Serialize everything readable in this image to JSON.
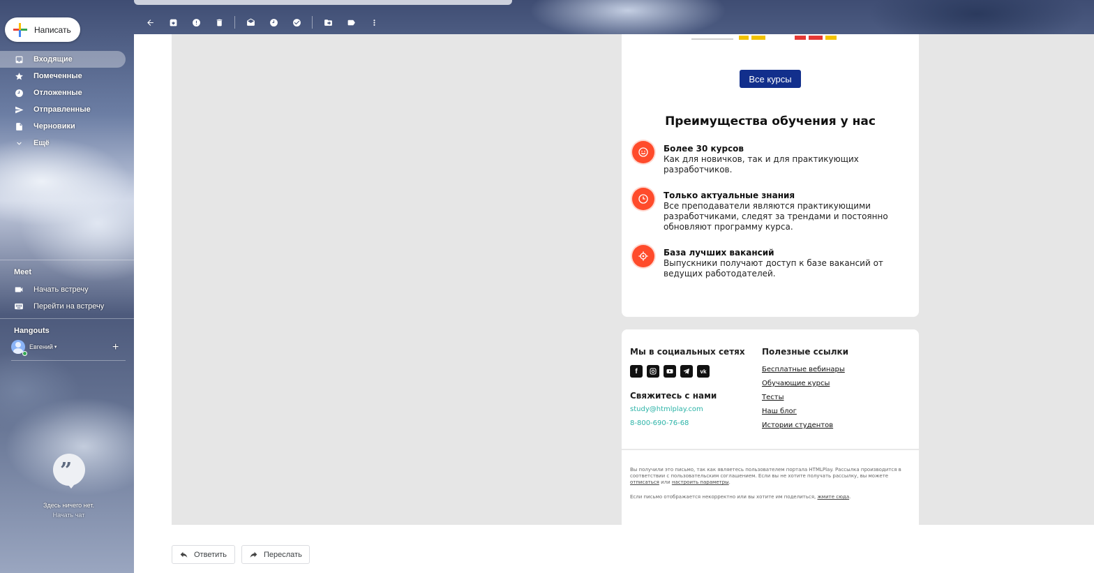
{
  "sidebar": {
    "compose_label": "Написать",
    "nav": [
      {
        "label": "Входящие",
        "icon": "inbox-icon",
        "active": true
      },
      {
        "label": "Помеченные",
        "icon": "star-icon"
      },
      {
        "label": "Отложенные",
        "icon": "clock-icon"
      },
      {
        "label": "Отправленные",
        "icon": "send-icon"
      },
      {
        "label": "Черновики",
        "icon": "draft-icon"
      },
      {
        "label": "Ещё",
        "icon": "chevron-down-icon"
      }
    ],
    "meet": {
      "title": "Meet",
      "start": "Начать встречу",
      "join": "Перейти на встречу"
    },
    "hangouts": {
      "title": "Hangouts",
      "user": "Евгений",
      "empty_text": "Здесь ничего нет.",
      "start_chat": "Начать чат"
    }
  },
  "email": {
    "all_courses_button": "Все курсы",
    "advantages_title": "Преимущества обучения у нас",
    "benefits": [
      {
        "title": "Более 30 курсов",
        "text": "Как для новичков, так и для практикующих разработчиков.",
        "icon": "smile-icon"
      },
      {
        "title": "Только актуальные знания",
        "text": "Все преподаватели являются практикующими разработчиками, следят за трендами и постоянно обновляют программу курса.",
        "icon": "clock-icon"
      },
      {
        "title": "База лучших вакансий",
        "text": "Выпускники получают доступ к базе вакансий от ведущих работодателей.",
        "icon": "target-icon"
      }
    ],
    "footer": {
      "social_title": "Мы в социальных сетях",
      "socials": [
        "facebook-icon",
        "instagram-icon",
        "youtube-icon",
        "telegram-icon",
        "vk-icon"
      ],
      "contact_title": "Свяжитесь с нами",
      "email": "study@htmlplay.com",
      "phone": "8-800-690-76-68",
      "links_title": "Полезные ссылки",
      "links": [
        "Бесплатные вебинары",
        "Обучающие курсы",
        "Тесты",
        "Наш блог",
        "Истории студентов"
      ],
      "fine_1a": "Вы получили это письмо, так как являетесь пользователем портала HTMLPlay. Рассылка производится в соответствии с пользовательским соглашением. Если вы не хотите получать рассылку, вы можете",
      "unsubscribe": "отписаться",
      "fine_or": "или",
      "settings": "настроить параметры",
      "fine_2": "Если письмо отображается некорректно или вы хотите им поделиться,",
      "click_here": "жмите сюда"
    }
  },
  "actions": {
    "reply": "Ответить",
    "forward": "Переслать"
  },
  "colors": {
    "accent_button": "#122f8c",
    "benefit_icon": "#ff4b2b",
    "contact_link": "#2bb3a7"
  }
}
